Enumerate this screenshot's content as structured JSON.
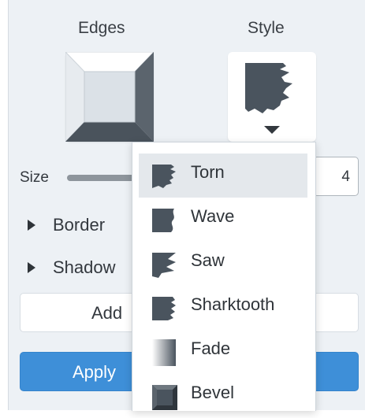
{
  "panel": {
    "edges_label": "Edges",
    "style_label": "Style",
    "size_label": "Size",
    "size_value": "4",
    "size_slider_fraction": 0.5,
    "border_label": "Border",
    "shadow_label": "Shadow",
    "add_button_label": "Add",
    "apply_button_label": "Apply"
  },
  "style_menu": {
    "selected": "Torn",
    "items": [
      {
        "label": "Torn",
        "icon": "torn-edge-icon"
      },
      {
        "label": "Wave",
        "icon": "wave-edge-icon"
      },
      {
        "label": "Saw",
        "icon": "saw-edge-icon"
      },
      {
        "label": "Sharktooth",
        "icon": "sharktooth-edge-icon"
      },
      {
        "label": "Fade",
        "icon": "fade-edge-icon"
      },
      {
        "label": "Bevel",
        "icon": "bevel-edge-icon"
      }
    ]
  },
  "colors": {
    "panel_bg": "#edf1f5",
    "accent": "#3e8fd8",
    "icon_dark": "#4a545e"
  }
}
